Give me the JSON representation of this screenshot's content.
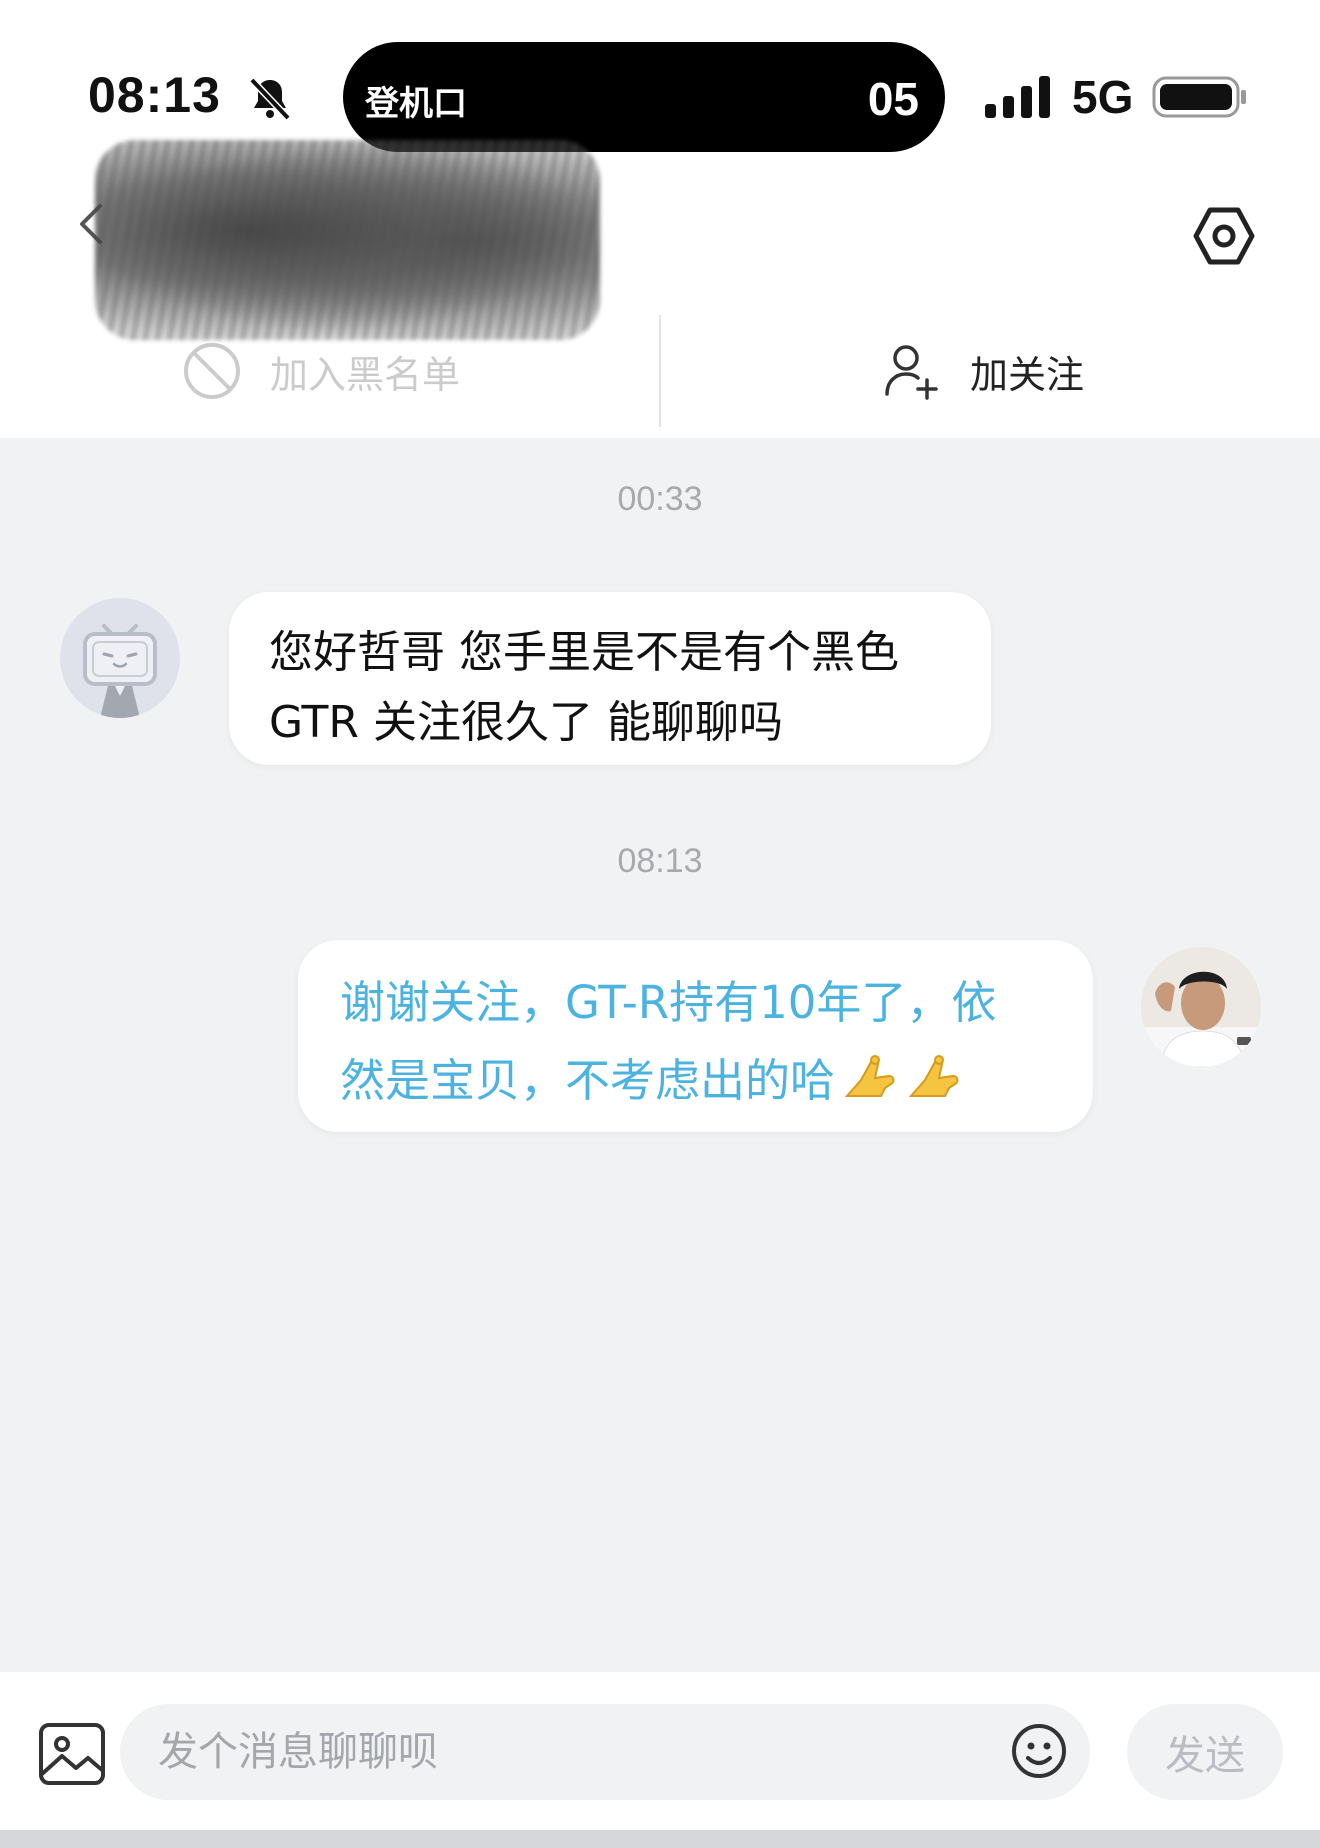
{
  "status_bar": {
    "time": "08:13",
    "island_label": "登机口",
    "island_number": "05",
    "network": "5G",
    "icons": [
      "bell-off-icon",
      "signal-icon",
      "battery-icon"
    ]
  },
  "header": {
    "icons": [
      "back-icon",
      "settings-icon"
    ],
    "name_redacted": true
  },
  "actions": {
    "block_label": "加入黑名单",
    "follow_label": "加关注"
  },
  "chat": {
    "messages": [
      {
        "timestamp": "00:33",
        "direction": "incoming",
        "line1": "您好哲哥 您手里是不是有个黑色",
        "line2": "GTR 关注很久了 能聊聊吗"
      },
      {
        "timestamp": "08:13",
        "direction": "outgoing",
        "line1": "谢谢关注，GT-R持有10年了，依",
        "line2": "然是宝贝，不考虑出的哈",
        "emoji": "🫰🫰"
      }
    ]
  },
  "input_bar": {
    "placeholder": "发个消息聊聊呗",
    "send_label": "发送",
    "icons": [
      "image-icon",
      "emoji-icon"
    ]
  },
  "colors": {
    "background": "#f1f2f4",
    "outgoing_text": "#4cb3e0",
    "timestamp": "#a7a9ad"
  }
}
